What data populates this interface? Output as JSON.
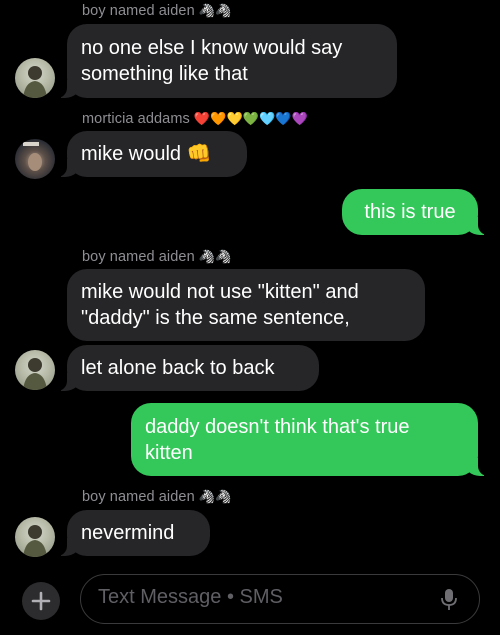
{
  "conversation": {
    "messages": [
      {
        "sender": "boy named aiden",
        "sender_emoji": "🦓🦓",
        "direction": "incoming",
        "lines": [
          "no one else I know would say",
          "something like that"
        ]
      },
      {
        "sender": "morticia addams",
        "sender_emoji": "❤️🧡💛💚🩵💙💜",
        "direction": "incoming",
        "lines": [
          "mike would 👊"
        ]
      },
      {
        "direction": "outgoing",
        "lines": [
          "this is true"
        ]
      },
      {
        "sender": "boy named aiden",
        "sender_emoji": "🦓🦓",
        "direction": "incoming",
        "lines": [
          "mike would not use \"kitten\" and",
          "\"daddy\" is the same sentence,"
        ]
      },
      {
        "direction": "incoming",
        "lines": [
          "let alone back to back"
        ]
      },
      {
        "direction": "outgoing",
        "lines": [
          "daddy doesn't think that's true",
          "kitten"
        ]
      },
      {
        "sender": "boy named aiden",
        "sender_emoji": "🦓🦓",
        "direction": "incoming",
        "lines": [
          "nevermind"
        ]
      }
    ]
  },
  "composer": {
    "add_button_icon": "plus-icon",
    "placeholder": "Text Message • SMS",
    "mic_icon": "microphone-icon"
  },
  "colors": {
    "background": "#000000",
    "incoming_bubble": "#262629",
    "outgoing_bubble": "#34c759",
    "sender_name": "#8e8e93"
  }
}
